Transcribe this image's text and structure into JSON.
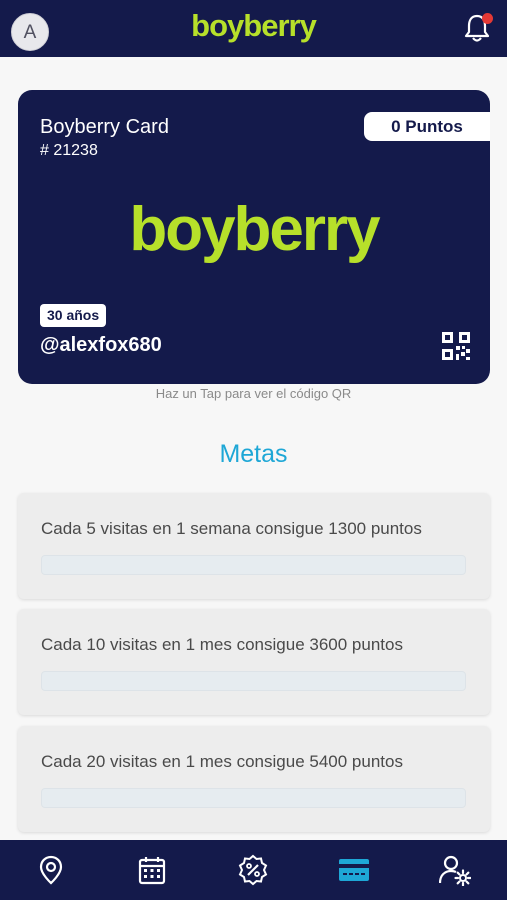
{
  "header": {
    "avatar_letter": "A",
    "brand": "boyberry",
    "notification_icon": "bell-icon",
    "has_notification": true
  },
  "card": {
    "title": "Boyberry Card",
    "number": "# 21238",
    "points": "0 Puntos",
    "logo": "boyberry",
    "age": "30 años",
    "username": "@alexfox680",
    "qr_icon": "qr-code-icon",
    "tap_hint": "Haz un Tap para ver el código QR"
  },
  "goals": {
    "title": "Metas",
    "items": [
      {
        "text": "Cada 5 visitas en 1 semana consigue 1300 puntos",
        "progress": 0
      },
      {
        "text": "Cada 10 visitas en 1 mes consigue 3600 puntos",
        "progress": 0
      },
      {
        "text": "Cada 20 visitas en 1 mes consigue 5400 puntos",
        "progress": 0
      }
    ]
  },
  "nav": {
    "items": [
      {
        "icon": "location-pin-icon",
        "active": false
      },
      {
        "icon": "calendar-icon",
        "active": false
      },
      {
        "icon": "discount-badge-icon",
        "active": false
      },
      {
        "icon": "card-icon",
        "active": true
      },
      {
        "icon": "user-settings-icon",
        "active": false
      }
    ]
  },
  "colors": {
    "navy": "#141a4b",
    "brand_green": "#b7e02a",
    "accent_blue": "#1ea7d6",
    "notification_red": "#e53935"
  }
}
